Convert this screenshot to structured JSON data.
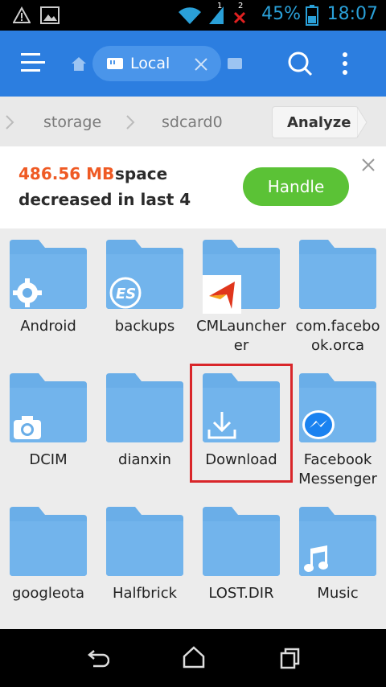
{
  "status": {
    "time": "18:07",
    "battery": "45%",
    "sim1": "1",
    "sim2": "2"
  },
  "header": {
    "tab_label": "Local"
  },
  "path": {
    "crumbs": [
      "storage",
      "sdcard0"
    ],
    "analyze_label": "Analyze"
  },
  "banner": {
    "amount": "486.56 MB",
    "line1": "space",
    "line2": "decreased in last 4",
    "button_label": "Handle"
  },
  "colors": {
    "accent": "#2c7ee0",
    "folder": "#6aaee8",
    "handle": "#5bc236",
    "highlight": "#d9262a"
  },
  "folders": [
    {
      "name": "Android",
      "icon": "gear-icon"
    },
    {
      "name": "backups",
      "icon": "es-logo-icon"
    },
    {
      "name": "CMLauncher",
      "icon": "cm-launcher-icon"
    },
    {
      "name": "com.facebook.orca",
      "icon": ""
    },
    {
      "name": "DCIM",
      "icon": "camera-icon"
    },
    {
      "name": "dianxin",
      "icon": ""
    },
    {
      "name": "Download",
      "icon": "download-icon"
    },
    {
      "name": "Facebook Messenger",
      "icon": "messenger-icon"
    },
    {
      "name": "googleota",
      "icon": ""
    },
    {
      "name": "Halfbrick",
      "icon": ""
    },
    {
      "name": "LOST.DIR",
      "icon": ""
    },
    {
      "name": "Music",
      "icon": "music-icon"
    }
  ]
}
